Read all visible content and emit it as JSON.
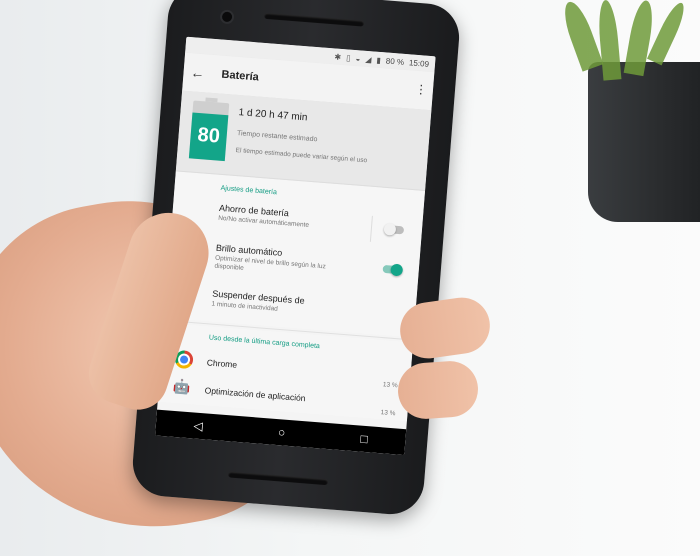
{
  "status_bar": {
    "battery_percent": "80 %",
    "time": "15:09",
    "icons": [
      "bluetooth-icon",
      "vibrate-icon",
      "wifi-icon",
      "signal-icon",
      "battery-icon"
    ]
  },
  "app_bar": {
    "title": "Batería",
    "back_icon": "arrow-back-icon",
    "menu_icon": "more-vert-icon"
  },
  "battery_card": {
    "level": "80",
    "level_fraction": 0.8,
    "time_remaining": "1 d 20 h 47 min",
    "time_label": "Tiempo restante estimado",
    "note": "El tiempo estimado puede variar según el uso"
  },
  "settings": {
    "header": "Ajustes de batería",
    "battery_saver": {
      "title": "Ahorro de batería",
      "subtitle": "No/No activar automáticamente",
      "enabled": false
    },
    "auto_brightness": {
      "title": "Brillo automático",
      "subtitle": "Optimizar el nivel de brillo según la luz disponible",
      "enabled": true
    },
    "sleep": {
      "title": "Suspender después de",
      "subtitle": "1 minuto de inactividad"
    }
  },
  "usage": {
    "header": "Uso desde la última carga completa",
    "apps": [
      {
        "name": "Chrome",
        "percent": "13 %",
        "icon": "chrome-icon"
      },
      {
        "name": "Optimización de aplicación",
        "percent": "13 %",
        "icon": "android-icon"
      }
    ]
  },
  "nav_bar": {
    "icons": [
      "back-triangle-icon",
      "home-circle-icon",
      "recents-square-icon"
    ]
  },
  "colors": {
    "accent": "#13a589",
    "screen_bg": "#f4f4f4",
    "phone_body": "#1b1c1e"
  }
}
